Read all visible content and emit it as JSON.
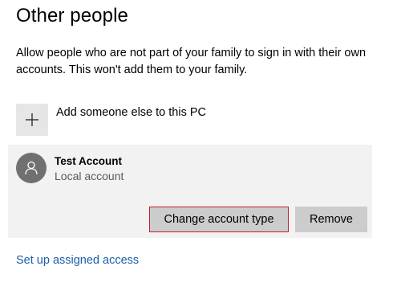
{
  "section": {
    "title": "Other people",
    "description": "Allow people who are not part of your family to sign in with their own accounts. This won't add them to your family."
  },
  "add_person": {
    "icon": "plus-icon",
    "label": "Add someone else to this PC"
  },
  "account": {
    "icon": "user-icon",
    "name": "Test Account",
    "type": "Local account",
    "change_button": "Change account type",
    "remove_button": "Remove"
  },
  "links": {
    "assigned_access": "Set up assigned access"
  },
  "colors": {
    "panel": "#f2f2f2",
    "button": "#cccccc",
    "focus_border": "#c4202c",
    "link": "#1a5ea8",
    "avatar": "#707070"
  }
}
